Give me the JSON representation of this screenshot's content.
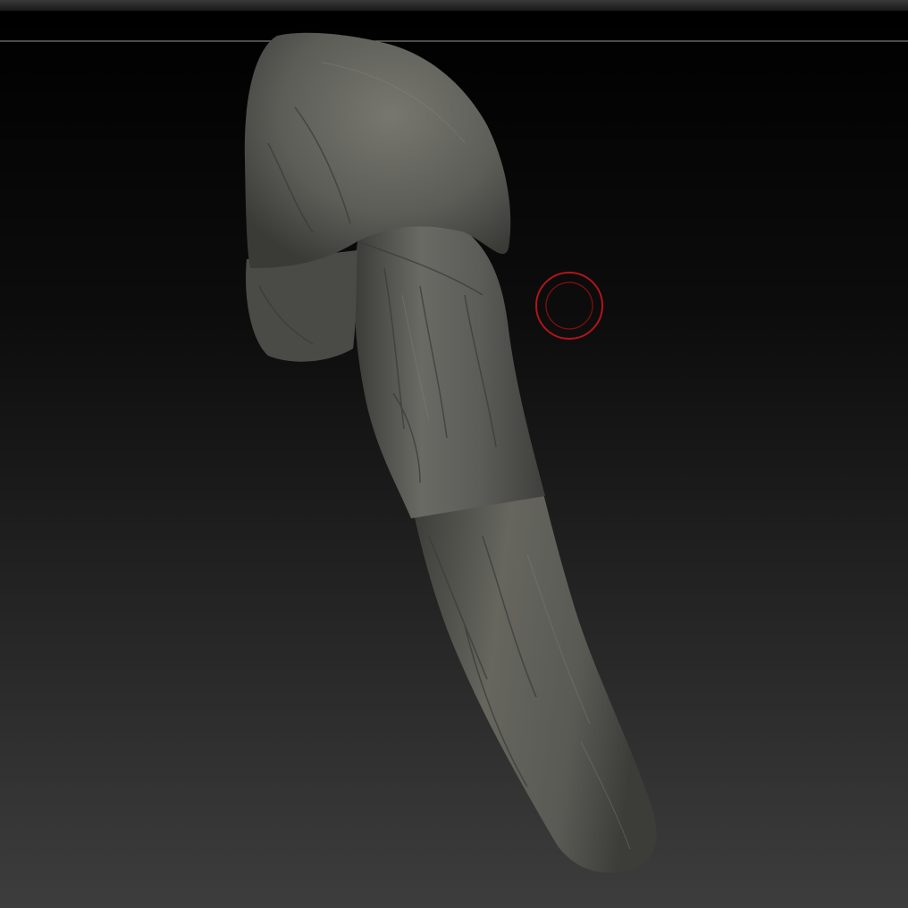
{
  "viewport": {
    "background_top": "#000000",
    "background_bottom": "#3d3d3d",
    "frame_line": "#7a7a7a",
    "model_fill": "#5a5a56",
    "model_highlight": "#7b7b76",
    "model_shadow": "#2c2c2a"
  },
  "brush_cursor": {
    "outer_color": "#b3141b",
    "inner_color": "#7a0e12"
  },
  "icons": {
    "brush": "brush-cursor-icon"
  }
}
